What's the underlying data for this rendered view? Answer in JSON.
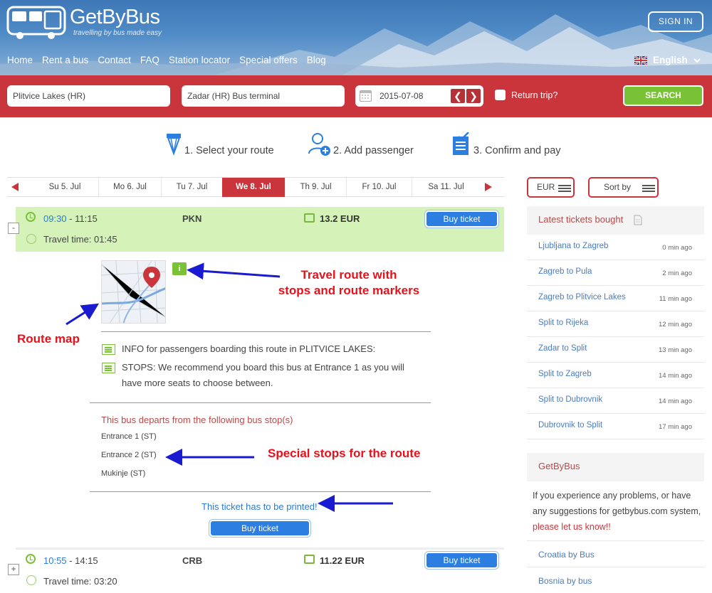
{
  "header": {
    "logo_text": "GetByBus",
    "tagline": "travelling by bus made easy",
    "signin": "SIGN IN",
    "nav": [
      "Home",
      "Rent a bus",
      "Contact",
      "FAQ",
      "Station locator",
      "Special offers",
      "Blog"
    ],
    "language": "English"
  },
  "search": {
    "from": "Plitvice Lakes (HR)",
    "to": "Zadar (HR) Bus terminal",
    "date": "2015-07-08",
    "return_label": "Return trip?",
    "return_checked": false,
    "search_button": "SEARCH",
    "prev_glyph": "❮",
    "next_glyph": "❯"
  },
  "steps": [
    "1. Select your route",
    "2. Add passenger",
    "3. Confirm and pay"
  ],
  "days": {
    "tabs": [
      "Su 5. Jul",
      "Mo 6. Jul",
      "Tu 7. Jul",
      "We 8. Jul",
      "Th 9. Jul",
      "Fr 10. Jul",
      "Sa 11. Jul"
    ],
    "active_index": 3
  },
  "routes": [
    {
      "depart": "09:30",
      "arrive": "- 11:15",
      "code": "PKN",
      "price": "13.2 EUR",
      "travel_time": "Travel time: 01:45",
      "buy": "Buy ticket",
      "toggle": "-",
      "expanded": true
    },
    {
      "depart": "10:55",
      "arrive": "- 14:15",
      "code": "CRB",
      "price": "11.22 EUR",
      "travel_time": "Travel time: 03:20",
      "buy": "Buy ticket",
      "toggle": "+",
      "expanded": false
    }
  ],
  "details": {
    "info_badge": "i",
    "info_line": "INFO for passengers boarding this route in PLITVICE LAKES:",
    "stops_line1": "STOPS: We recommend you board this bus at Entrance 1 as you will",
    "stops_line2": "have more seats to choose between.",
    "departs_title": "This bus departs from the following bus stop(s)",
    "stops": [
      "Entrance 1 (ST)",
      "Entrance 2 (ST)",
      "Mukinje (ST)"
    ],
    "printed_note": "This ticket has to be printed!",
    "buy": "Buy ticket"
  },
  "annotations": {
    "route_info_line1": "Travel route with",
    "route_info_line2": "stops and route markers",
    "route_map": "Route map",
    "special_stops": "Special stops for the route"
  },
  "sidebar": {
    "currency": "EUR",
    "sort": "Sort by",
    "latest_title": "Latest tickets bought",
    "latest": [
      {
        "route": "Ljubljana to Zagreb",
        "ago": "0 min ago"
      },
      {
        "route": "Zagreb to Pula",
        "ago": "2 min ago"
      },
      {
        "route": "Zagreb to Plitvice Lakes",
        "ago": "11 min ago"
      },
      {
        "route": "Split to Rijeka",
        "ago": "12 min ago"
      },
      {
        "route": "Zadar to Split",
        "ago": "13 min ago"
      },
      {
        "route": "Split to Zagreb",
        "ago": "14 min ago"
      },
      {
        "route": "Split to Dubrovnik",
        "ago": "14 min ago"
      },
      {
        "route": "Dubrovnik to Split",
        "ago": "17 min ago"
      }
    ],
    "getbybus_title": "GetByBus",
    "getbybus_text1": "If you experience any problems, or have any suggestions for getbybus.com system,",
    "getbybus_link": "please let us know!!",
    "links": [
      "Croatia by Bus",
      "Bosnia by bus"
    ]
  },
  "colors": {
    "brand_red": "#c9353b",
    "accent_green": "#79c236",
    "link_blue": "#2a7bd8",
    "annotation_red": "#e8111b",
    "annotation_arrow": "#1a1ad0"
  }
}
